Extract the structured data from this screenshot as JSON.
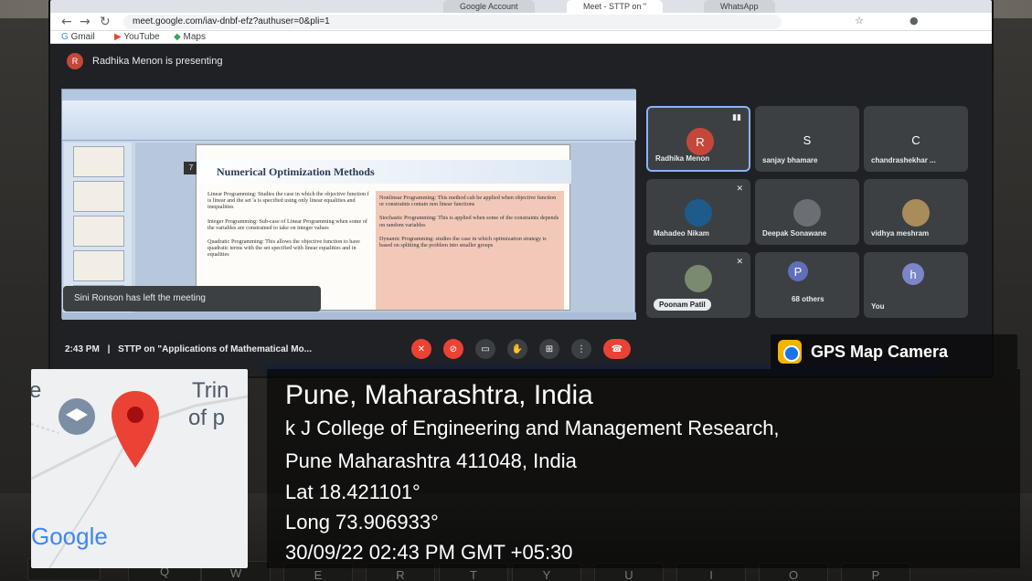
{
  "browser": {
    "tabs": [
      {
        "label": "Google Account"
      },
      {
        "label": "Meet - STTP on \""
      },
      {
        "label": "WhatsApp"
      }
    ],
    "url": "meet.google.com/iav-dnbf-efz?authuser=0&pli=1",
    "bookmarks": [
      "Gmail",
      "YouTube",
      "Maps"
    ]
  },
  "meet": {
    "presenting_text": "Radhika Menon is presenting",
    "presenter_initial": "R",
    "toast": "Sini Ronson has left the meeting",
    "time": "2:43 PM",
    "meeting_title": "STTP on \"Applications of Mathematical Mo...",
    "participants": [
      {
        "name": "Radhika Menon",
        "initial": "R",
        "color": "#c5473a"
      },
      {
        "name": "sanjay bhamare",
        "initial": "S",
        "color": "#3c4043"
      },
      {
        "name": "chandrashekhar ...",
        "initial": "C",
        "color": "#3c4043"
      },
      {
        "name": "Mahadeo Nikam",
        "initial": "",
        "color": "#1e5a8a"
      },
      {
        "name": "Deepak Sonawane",
        "initial": "",
        "color": "#6b6f74"
      },
      {
        "name": "vidhya meshram",
        "initial": "",
        "color": "#a88c5a"
      },
      {
        "name": "Poonam Patil",
        "initial": "",
        "color": "#7a8a70"
      },
      {
        "name": "68 others",
        "initial": "P",
        "color": "#5f6fb8"
      },
      {
        "name": "You",
        "initial": "h",
        "color": "#7a86c8"
      }
    ]
  },
  "slide": {
    "number": "7",
    "title": "Numerical Optimization Methods",
    "left": [
      "Linear Programming: Studies the case in which the objective function f is linear and the set 'a is specified using only linear equalities and inequalities",
      "Integer Programming: Sub-case of Linear Programming when some of the variables are constrained to take on integer values",
      "Quadratic Programming: This allows the objective function to have quadratic terms with the set specified with linear equalities and in equalities"
    ],
    "right": [
      "Nonlinear Programming: This method cab be applied when objective function or constraints contain non linear functions",
      "Stochastic Programming: This is applied when some of the constraints depends on random variables",
      "Dynamic Programming: studies the case in which optimization strategy is based on splitting the problem into smaller groups"
    ]
  },
  "gps": {
    "app_label": "GPS Map Camera",
    "map_brand": "Google",
    "map_text_right1": "Trin",
    "map_text_right2": "of p",
    "map_text_left": "e",
    "city": "Pune, Maharashtra, India",
    "address_line1": "k J College of Engineering and Management Research,",
    "address_line2": "Pune Maharashtra 411048, India",
    "latitude": "Lat 18.421101°",
    "longitude": "Long 73.906933°",
    "datetime": "30/09/22 02:43 PM GMT +05:30"
  },
  "keyboard": [
    "Q",
    "W",
    "E",
    "R",
    "T",
    "Y",
    "U",
    "I",
    "O",
    "P"
  ]
}
